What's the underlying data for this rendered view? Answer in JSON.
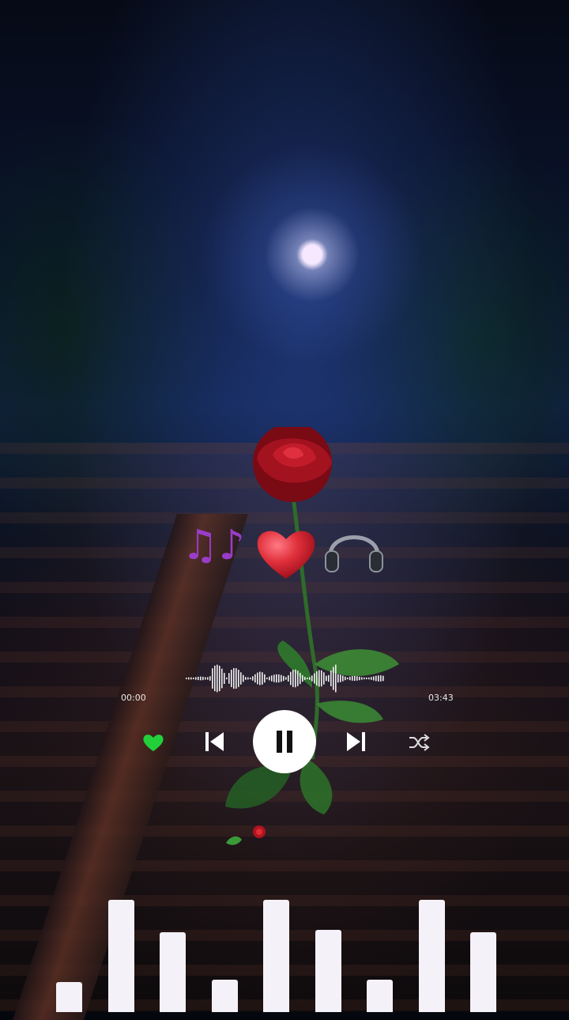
{
  "player": {
    "elapsed_time": "00:00",
    "total_time": "03:43",
    "progress": 0.0,
    "liked": true,
    "is_playing": true
  },
  "controls": {
    "like_icon": "heart-icon",
    "prev_icon": "skip-previous-icon",
    "play_pause_icon": "pause-icon",
    "next_icon": "skip-next-icon",
    "shuffle_icon": "shuffle-icon"
  },
  "decor": {
    "emojis": [
      "music-notes-icon",
      "red-heart-icon",
      "headphones-icon"
    ]
  },
  "visualizer": {
    "levels": [
      0.27,
      1.0,
      0.71,
      0.29,
      1.0,
      0.73,
      0.29,
      1.0,
      0.71
    ]
  },
  "colors": {
    "like_active": "#22d03a",
    "notes": "#9a3cc8",
    "heart": "#e0303c",
    "control_white": "#ffffff",
    "visualizer_bar": "#f4f1f8"
  }
}
